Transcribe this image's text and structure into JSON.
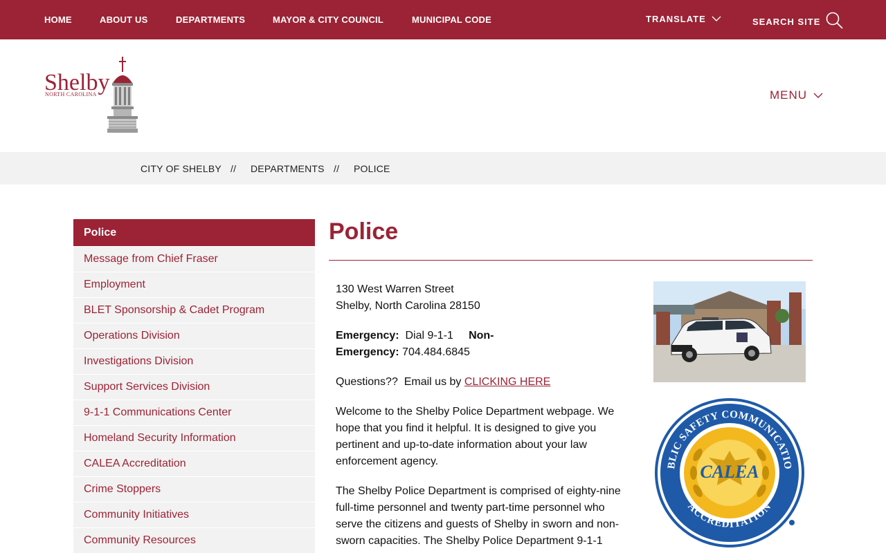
{
  "topnav": {
    "items": [
      "HOME",
      "ABOUT US",
      "DEPARTMENTS",
      "MAYOR & CITY COUNCIL",
      "MUNICIPAL CODE"
    ],
    "translate_label": "TRANSLATE",
    "search_label": "SEARCH SITE"
  },
  "header": {
    "logo_text": "Shelby",
    "logo_subtext": "NORTH CAROLINA",
    "menu_label": "MENU"
  },
  "breadcrumb": {
    "items": [
      "CITY OF SHELBY",
      "DEPARTMENTS",
      "POLICE"
    ],
    "separator": "//"
  },
  "sidebar": {
    "items": [
      "Police",
      "Message from Chief Fraser",
      "Employment",
      "BLET Sponsorship & Cadet Program",
      "Operations Division",
      "Investigations Division",
      "Support Services Division",
      "9-1-1 Communications Center",
      "Homeland Security Information",
      "CALEA Accreditation",
      "Crime Stoppers",
      "Community Initiatives",
      "Community Resources"
    ]
  },
  "main": {
    "title": "Police",
    "address_line1": "130 West Warren Street",
    "address_line2": "Shelby, North Carolina 28150",
    "emergency_label": "Emergency:",
    "emergency_value": "Dial 9-1-1",
    "nonemergency_label_1": "Non-",
    "nonemergency_label_2": "Emergency:",
    "nonemergency_value": "704.484.6845",
    "questions_text": "Questions??  Email us by ",
    "questions_link": "CLICKING HERE",
    "welcome_lines": [
      "Welcome to the Shelby Police Department webpage.  We",
      "hope that you find it helpful. It is designed to give you",
      "pertinent and up-to-date information about your law",
      "enforcement agency."
    ],
    "comprised_lines": [
      "The Shelby Police Department is comprised of eighty-nine",
      "full-time personnel and twenty part-time personnel who",
      "serve the citizens and guests of Shelby in sworn and non-",
      "sworn capacities.  The Shelby Police Department 9-1-1"
    ]
  },
  "seal": {
    "top_text": "PUBLIC SAFETY COMMUNICATIONS",
    "bottom_text": "ACCREDITATION",
    "center_text": "CALEA"
  },
  "colors": {
    "brand": "#9b2335",
    "sidebar_bg": "#f2f2f2",
    "seal_blue": "#1f5aa8",
    "seal_gold": "#f2b81e"
  }
}
